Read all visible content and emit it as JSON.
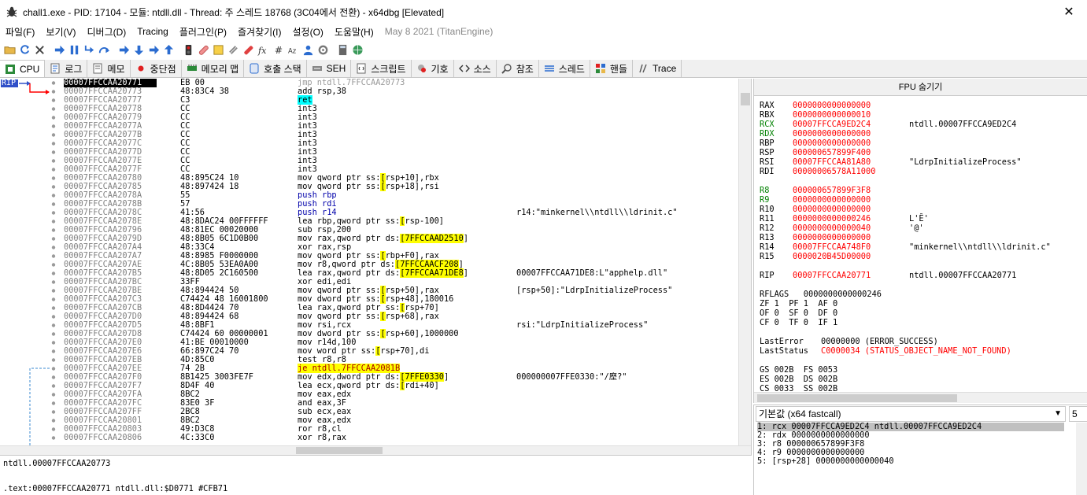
{
  "window": {
    "title": "chall1.exe - PID: 17104 - 모듈: ntdll.dll - Thread: 주 스레드 18768 (3C04에서 전환) - x64dbg [Elevated]",
    "close_glyph": "✕"
  },
  "menu": {
    "items": [
      "파일(F)",
      "보기(V)",
      "디버그(D)",
      "Tracing",
      "플러그인(P)",
      "즐겨찾기(I)",
      "설정(O)",
      "도움말(H)"
    ],
    "version": "May 8 2021 (TitanEngine)"
  },
  "tabs": [
    {
      "label": "CPU",
      "icon": "cpu-icon",
      "active": true
    },
    {
      "label": "로그",
      "icon": "log-icon"
    },
    {
      "label": "메모",
      "icon": "notes-icon"
    },
    {
      "label": "중단점",
      "icon": "breakpoint-icon"
    },
    {
      "label": "메모리 맵",
      "icon": "memory-map-icon"
    },
    {
      "label": "호출 스택",
      "icon": "call-stack-icon"
    },
    {
      "label": "SEH",
      "icon": "seh-icon"
    },
    {
      "label": "스크립트",
      "icon": "script-icon"
    },
    {
      "label": "기호",
      "icon": "symbols-icon"
    },
    {
      "label": "소스",
      "icon": "source-icon"
    },
    {
      "label": "참조",
      "icon": "references-icon"
    },
    {
      "label": "스레드",
      "icon": "threads-icon"
    },
    {
      "label": "핸들",
      "icon": "handles-icon"
    },
    {
      "label": "Trace",
      "icon": "trace-icon"
    }
  ],
  "disasm": {
    "rip_label": "RIP",
    "rows": [
      {
        "addr": "00007FFCCAA20771",
        "bytes": "EB 00",
        "instr": "jmp ntdll.7FFCCAA20773",
        "cmt": "",
        "style": "cur"
      },
      {
        "addr": "00007FFCCAA20773",
        "bytes": "48:83C4 38",
        "instr": "add rsp,38",
        "cmt": ""
      },
      {
        "addr": "00007FFCCAA20777",
        "bytes": "C3",
        "instr": "ret",
        "cmt": "",
        "style": "ret"
      },
      {
        "addr": "00007FFCCAA20778",
        "bytes": "CC",
        "instr": "int3",
        "cmt": ""
      },
      {
        "addr": "00007FFCCAA20779",
        "bytes": "CC",
        "instr": "int3",
        "cmt": ""
      },
      {
        "addr": "00007FFCCAA2077A",
        "bytes": "CC",
        "instr": "int3",
        "cmt": ""
      },
      {
        "addr": "00007FFCCAA2077B",
        "bytes": "CC",
        "instr": "int3",
        "cmt": ""
      },
      {
        "addr": "00007FFCCAA2077C",
        "bytes": "CC",
        "instr": "int3",
        "cmt": ""
      },
      {
        "addr": "00007FFCCAA2077D",
        "bytes": "CC",
        "instr": "int3",
        "cmt": ""
      },
      {
        "addr": "00007FFCCAA2077E",
        "bytes": "CC",
        "instr": "int3",
        "cmt": ""
      },
      {
        "addr": "00007FFCCAA2077F",
        "bytes": "CC",
        "instr": "int3",
        "cmt": ""
      },
      {
        "addr": "00007FFCCAA20780",
        "bytes": "48:895C24 10",
        "instr": "mov qword ptr ss:[rsp+10],rbx",
        "cmt": ""
      },
      {
        "addr": "00007FFCCAA20785",
        "bytes": "48:897424 18",
        "instr": "mov qword ptr ss:[rsp+18],rsi",
        "cmt": ""
      },
      {
        "addr": "00007FFCCAA2078A",
        "bytes": "55",
        "instr": "push rbp",
        "cmt": "",
        "style": "push"
      },
      {
        "addr": "00007FFCCAA2078B",
        "bytes": "57",
        "instr": "push rdi",
        "cmt": "",
        "style": "push"
      },
      {
        "addr": "00007FFCCAA2078C",
        "bytes": "41:56",
        "instr": "push r14",
        "cmt": "r14:\"minkernel\\\\ntdll\\\\ldrinit.c\"",
        "style": "push"
      },
      {
        "addr": "00007FFCCAA2078E",
        "bytes": "48:8DAC24 00FFFFFF",
        "instr": "lea rbp,qword ptr ss:[rsp-100]",
        "cmt": ""
      },
      {
        "addr": "00007FFCCAA20796",
        "bytes": "48:81EC 00020000",
        "instr": "sub rsp,200",
        "cmt": ""
      },
      {
        "addr": "00007FFCCAA2079D",
        "bytes": "48:8B05 6C1D0B00",
        "instr": "mov rax,qword ptr ds:[7FFCCAAD2510]",
        "cmt": "",
        "hl": "7FFCCAAD2510"
      },
      {
        "addr": "00007FFCCAA207A4",
        "bytes": "48:33C4",
        "instr": "xor rax,rsp",
        "cmt": ""
      },
      {
        "addr": "00007FFCCAA207A7",
        "bytes": "48:8985 F0000000",
        "instr": "mov qword ptr ss:[rbp+F0],rax",
        "cmt": ""
      },
      {
        "addr": "00007FFCCAA207AE",
        "bytes": "4C:8B05 53EA0A00",
        "instr": "mov r8,qword ptr ds:[7FFCCAACF208]",
        "cmt": "",
        "hl": "7FFCCAACF208"
      },
      {
        "addr": "00007FFCCAA207B5",
        "bytes": "48:8D05 2C160500",
        "instr": "lea rax,qword ptr ds:[7FFCCAA71DE8]",
        "cmt": "00007FFCCAA71DE8:L\"apphelp.dll\"",
        "hl": "7FFCCAA71DE8"
      },
      {
        "addr": "00007FFCCAA207BC",
        "bytes": "33FF",
        "instr": "xor edi,edi",
        "cmt": ""
      },
      {
        "addr": "00007FFCCAA207BE",
        "bytes": "48:894424 50",
        "instr": "mov qword ptr ss:[rsp+50],rax",
        "cmt": "[rsp+50]:\"LdrpInitializeProcess\""
      },
      {
        "addr": "00007FFCCAA207C3",
        "bytes": "C74424 48 16001800",
        "instr": "mov dword ptr ss:[rsp+48],180016",
        "cmt": ""
      },
      {
        "addr": "00007FFCCAA207CB",
        "bytes": "48:8D4424 70",
        "instr": "lea rax,qword ptr ss:[rsp+70]",
        "cmt": ""
      },
      {
        "addr": "00007FFCCAA207D0",
        "bytes": "48:894424 68",
        "instr": "mov qword ptr ss:[rsp+68],rax",
        "cmt": ""
      },
      {
        "addr": "00007FFCCAA207D5",
        "bytes": "48:8BF1",
        "instr": "mov rsi,rcx",
        "cmt": "rsi:\"LdrpInitializeProcess\""
      },
      {
        "addr": "00007FFCCAA207D8",
        "bytes": "C74424 60 00000001",
        "instr": "mov dword ptr ss:[rsp+60],1000000",
        "cmt": ""
      },
      {
        "addr": "00007FFCCAA207E0",
        "bytes": "41:BE 00010000",
        "instr": "mov r14d,100",
        "cmt": ""
      },
      {
        "addr": "00007FFCCAA207E6",
        "bytes": "66:897C24 70",
        "instr": "mov word ptr ss:[rsp+70],di",
        "cmt": ""
      },
      {
        "addr": "00007FFCCAA207EB",
        "bytes": "4D:85C0",
        "instr": "test r8,r8",
        "cmt": ""
      },
      {
        "addr": "00007FFCCAA207EE",
        "bytes": "74 2B",
        "instr": "je ntdll.7FFCCAA2081B",
        "cmt": "",
        "style": "je"
      },
      {
        "addr": "00007FFCCAA207F0",
        "bytes": "8B1425 3003FE7F",
        "instr": "mov edx,dword ptr ds:[7FFE0330]",
        "cmt": "000000007FFE0330:\"/塺?\"",
        "hl": "7FFE0330"
      },
      {
        "addr": "00007FFCCAA207F7",
        "bytes": "8D4F 40",
        "instr": "lea ecx,qword ptr ds:[rdi+40]",
        "cmt": ""
      },
      {
        "addr": "00007FFCCAA207FA",
        "bytes": "8BC2",
        "instr": "mov eax,edx",
        "cmt": ""
      },
      {
        "addr": "00007FFCCAA207FC",
        "bytes": "83E0 3F",
        "instr": "and eax,3F",
        "cmt": ""
      },
      {
        "addr": "00007FFCCAA207FF",
        "bytes": "2BC8",
        "instr": "sub ecx,eax",
        "cmt": ""
      },
      {
        "addr": "00007FFCCAA20801",
        "bytes": "8BC2",
        "instr": "mov eax,edx",
        "cmt": ""
      },
      {
        "addr": "00007FFCCAA20803",
        "bytes": "49:D3C8",
        "instr": "ror r8,cl",
        "cmt": ""
      },
      {
        "addr": "00007FFCCAA20806",
        "bytes": "4C:33C0",
        "instr": "xor r8,rax",
        "cmt": ""
      }
    ]
  },
  "info": {
    "line1": "ntdll.00007FFCCAA20773",
    "line2": ".text:00007FFCCAA20771 ntdll.dll:$D0771 #CFB71"
  },
  "fpu": {
    "header": "FPU 숨기기",
    "gp": [
      {
        "name": "RAX",
        "value": "0000000000000000",
        "comment": ""
      },
      {
        "name": "RBX",
        "value": "0000000000000010",
        "comment": ""
      },
      {
        "name": "RCX",
        "value": "00007FFCCA9ED2C4",
        "comment": "ntdll.00007FFCCA9ED2C4",
        "changed": true
      },
      {
        "name": "RDX",
        "value": "0000000000000000",
        "comment": "",
        "changed": true
      },
      {
        "name": "RBP",
        "value": "0000000000000000",
        "comment": ""
      },
      {
        "name": "RSP",
        "value": "000000657899F400",
        "comment": ""
      },
      {
        "name": "RSI",
        "value": "00007FFCCAA81A80",
        "comment": "\"LdrpInitializeProcess\""
      },
      {
        "name": "RDI",
        "value": "00000006578A11000",
        "comment": ""
      }
    ],
    "ext": [
      {
        "name": "R8",
        "value": "000000657899F3F8",
        "comment": "",
        "changed": true
      },
      {
        "name": "R9",
        "value": "0000000000000000",
        "comment": "",
        "changed": true
      },
      {
        "name": "R10",
        "value": "0000000000000000",
        "comment": ""
      },
      {
        "name": "R11",
        "value": "0000000000000246",
        "comment": "L'Ȇ'"
      },
      {
        "name": "R12",
        "value": "0000000000000040",
        "comment": "'@'"
      },
      {
        "name": "R13",
        "value": "0000000000000000",
        "comment": ""
      },
      {
        "name": "R14",
        "value": "00007FFCCAA748F0",
        "comment": "\"minkernel\\\\ntdll\\\\ldrinit.c\""
      },
      {
        "name": "R15",
        "value": "0000020B45D00000",
        "comment": ""
      }
    ],
    "rip": {
      "name": "RIP",
      "value": "00007FFCCAA20771",
      "comment": "ntdll.00007FFCCAA20771"
    },
    "rflags": "RFLAGS   0000000000000246",
    "flags1": "ZF 1  PF 1  AF 0",
    "flags2": "OF 0  SF 0  DF 0",
    "flags3": "CF 0  TF 0  IF 1",
    "lasterror_label": "LastError",
    "lasterror_value": "00000000 (ERROR_SUCCESS)",
    "laststatus_label": "LastStatus",
    "laststatus_value": "C0000034 (STATUS_OBJECT_NAME_NOT_FOUND)",
    "seg1": "GS 002B  FS 0053",
    "seg2": "ES 002B  DS 002B",
    "seg3": "CS 0033  SS 002B"
  },
  "callconv": {
    "combo": "기본값 (x64 fastcall)",
    "count": "5",
    "args": [
      "1: rcx 00007FFCCA9ED2C4 ntdll.00007FFCCA9ED2C4",
      "2: rdx 0000000000000000",
      "3: r8 000000657899F3F8",
      "4: r9 0000000000000000",
      "5: [rsp+28] 0000000000000040"
    ]
  }
}
